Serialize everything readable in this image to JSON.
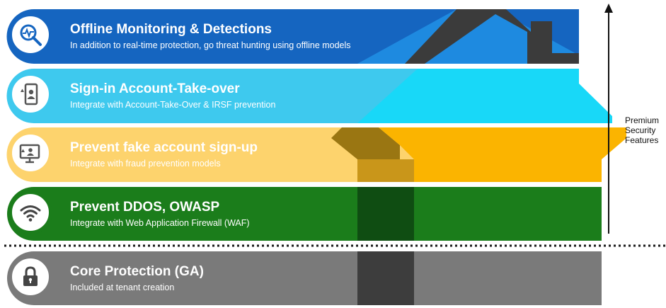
{
  "layers": [
    {
      "id": "offline",
      "title": "Offline Monitoring & Detections",
      "subtitle": "In addition to real-time protection, go threat hunting using offline models",
      "icon": "magnifier-pulse-icon",
      "color": "#1565c0",
      "text_color": "#ffffff"
    },
    {
      "id": "signin",
      "title": "Sign-in Account-Take-over",
      "subtitle": "Integrate with Account-Take-Over & IRSF prevention",
      "icon": "phone-user-alert-icon",
      "color": "#3ec9ee",
      "text_color": "#ffffff"
    },
    {
      "id": "signup",
      "title": "Prevent fake account sign-up",
      "subtitle": "Integrate with fraud prevention models",
      "icon": "monitor-user-alert-icon",
      "color": "#fdd36d",
      "text_color": "#ffffff"
    },
    {
      "id": "ddos",
      "title": "Prevent DDOS, OWASP",
      "subtitle": "Integrate with Web Application Firewall (WAF)",
      "icon": "wifi-icon",
      "color": "#1b7d1b",
      "text_color": "#ffffff"
    },
    {
      "id": "core",
      "title": "Core Protection (GA)",
      "subtitle": "Included at tenant creation",
      "icon": "lock-icon",
      "color": "#7a7a7a",
      "text_color": "#ffffff"
    }
  ],
  "premium_label": [
    "Premium",
    "Security",
    "Features"
  ],
  "house_colors": {
    "roof_blue": "#1e8ae0",
    "roof_cyan": "#18d8f8",
    "body_yellow": "#fbb400",
    "chimney_dark": "#3b3b3b",
    "door_gold": "#c9961a",
    "door_green": "#0f4d12",
    "door_gray": "#3d3d3d",
    "eave_shadow": "#9a7612"
  }
}
